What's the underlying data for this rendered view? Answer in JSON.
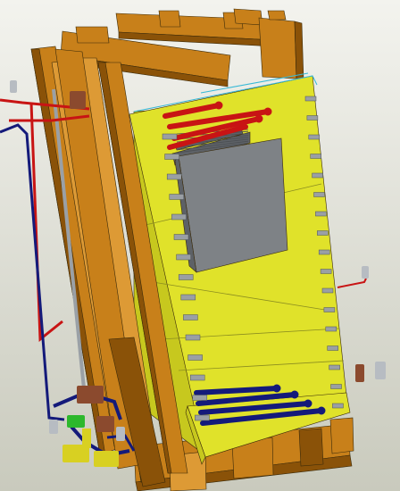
{
  "view": {
    "background_top": "#f3f3ee",
    "background_bottom": "#c9cabd"
  },
  "model": {
    "wood_color": "#c8801a",
    "wood_dark": "#8a5208",
    "wood_light": "#dd9a35",
    "panel_color": "#e0e22a",
    "panel_shade": "#c7c81e",
    "radiator_color": "#7e8286",
    "hot_pipe_color": "#c81414",
    "cold_pipe_color": "#141a7a",
    "clip_color": "#9a9fa4",
    "valve_color": "#8b4a2e",
    "pump_color": "#2cb82c",
    "fitting_color": "#d8d022",
    "sensor_color": "#b7bcc2",
    "parts": [
      "frame-post-left",
      "frame-post-mid",
      "frame-post-inner",
      "top-beam-back",
      "top-beam-front",
      "top-crossbars",
      "base-beams",
      "panel-back-wall",
      "panel-side-wall",
      "panel-floor",
      "radiator",
      "hot-pipes",
      "cold-pipes",
      "supply-line-left",
      "return-line-left",
      "valves",
      "pump",
      "fittings",
      "sensors",
      "panel-clips"
    ]
  }
}
